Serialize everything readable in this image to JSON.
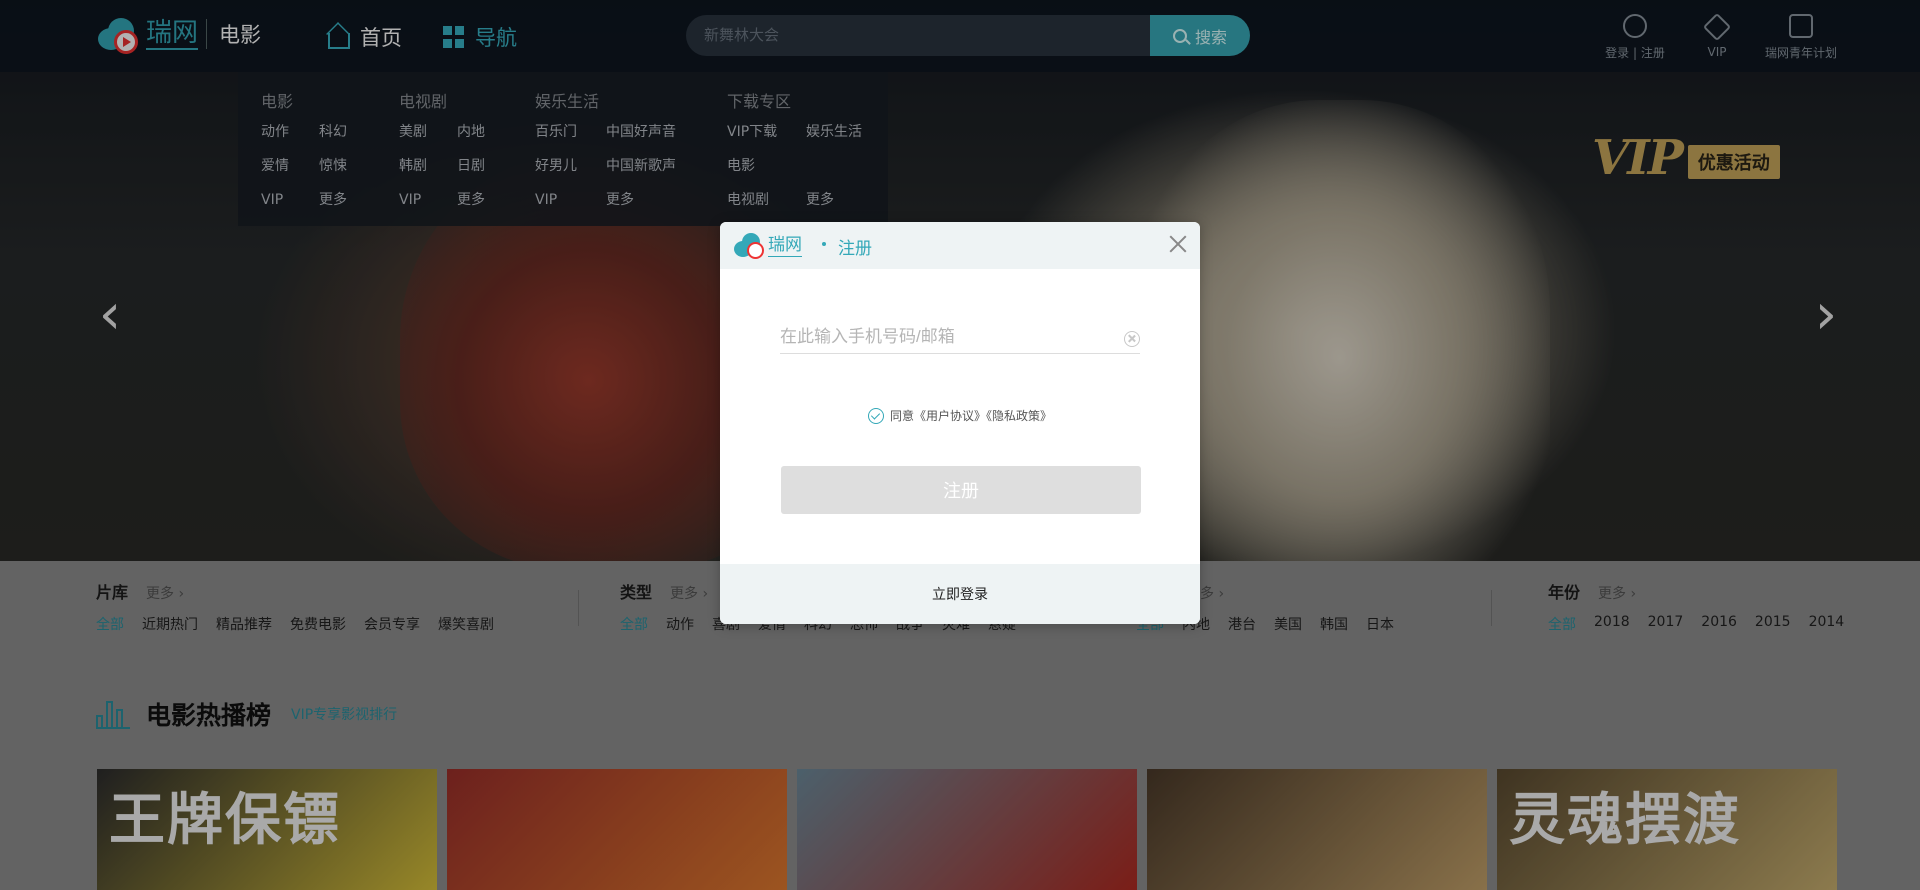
{
  "header": {
    "logo_name": "瑞网",
    "section": "电影",
    "nav": {
      "home": "首页",
      "guide": "导航"
    },
    "search": {
      "placeholder": "新舞林大会",
      "button": "搜索"
    },
    "tools": {
      "login": "登录",
      "register": "注册",
      "login_sep": "|",
      "vip": "VIP",
      "youth": "瑞网青年计划"
    }
  },
  "dropdown": {
    "columns": [
      {
        "title": "电影",
        "items": [
          "动作",
          "科幻",
          "爱情",
          "惊悚",
          "VIP",
          "更多"
        ]
      },
      {
        "title": "电视剧",
        "items": [
          "美剧",
          "内地",
          "韩剧",
          "日剧",
          "VIP",
          "更多"
        ]
      },
      {
        "title": "娱乐生活",
        "items": [
          "百乐门",
          "中国好声音",
          "好男儿",
          "中国新歌声",
          "VIP",
          "更多"
        ]
      },
      {
        "title": "下载专区",
        "items": [
          "VIP下载",
          "娱乐生活",
          "电影",
          "",
          "电视剧",
          "更多"
        ]
      }
    ]
  },
  "hero": {
    "promo_big": "VIP",
    "promo_tag": "优惠活动",
    "prev": "‹",
    "next": "›"
  },
  "categories": {
    "library": {
      "title": "片库",
      "more": "更多 ›",
      "items": [
        "全部",
        "近期热门",
        "精品推荐",
        "免费电影",
        "会员专享",
        "爆笑喜剧"
      ]
    },
    "type": {
      "title": "类型",
      "more": "更多 ›",
      "items": [
        "全部",
        "动作",
        "喜剧",
        "爱情",
        "科幻",
        "恐怖",
        "战争",
        "灾难",
        "悬疑"
      ]
    },
    "region": {
      "more": "更多 ›",
      "items": [
        "全部",
        "内地",
        "港台",
        "美国",
        "韩国",
        "日本"
      ]
    },
    "year": {
      "title": "年份",
      "more": "更多 ›",
      "items": [
        "全部",
        "2018",
        "2017",
        "2016",
        "2015",
        "2014"
      ]
    }
  },
  "hot": {
    "title": "电影热播榜",
    "subtitle": "VIP专享影视排行"
  },
  "posters": [
    {
      "text": "王牌保镖",
      "colors": [
        "#2d2d2d",
        "#d9c23a"
      ]
    },
    {
      "text": "",
      "colors": [
        "#9c2f2a",
        "#e07a2e"
      ]
    },
    {
      "text": "",
      "colors": [
        "#6d8a9a",
        "#b02b22"
      ]
    },
    {
      "text": "",
      "colors": [
        "#4b3a2a",
        "#c4a26a"
      ]
    },
    {
      "text": "灵魂摆渡",
      "colors": [
        "#5a4a30",
        "#c9b070"
      ]
    }
  ],
  "modal": {
    "logo_name": "瑞网",
    "title": "注册",
    "input_placeholder": "在此输入手机号码/邮箱",
    "agree_text": "同意《用户协议》《隐私政策》",
    "submit": "注册",
    "login_link": "立即登录"
  }
}
